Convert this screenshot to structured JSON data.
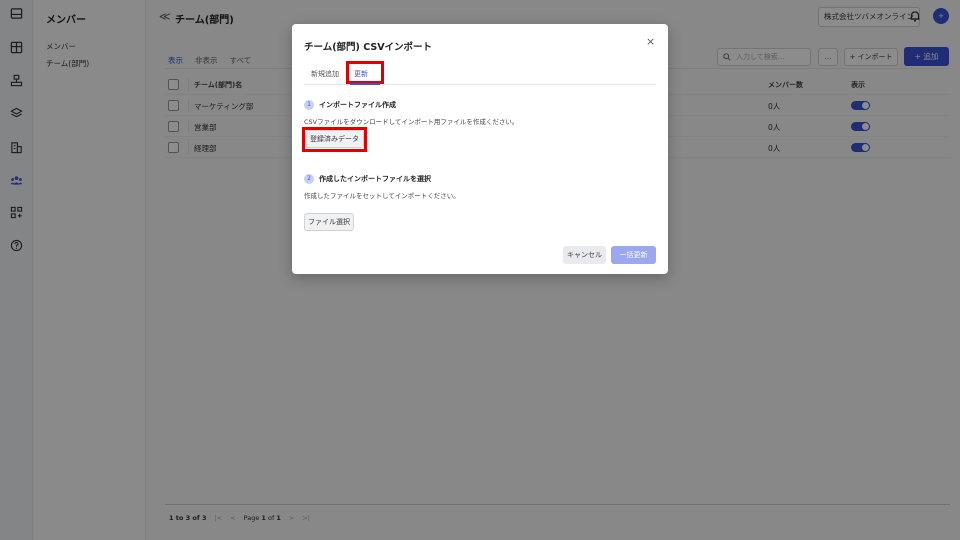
{
  "rail": {
    "icons": [
      "inbox-icon",
      "columns-icon",
      "org-chart-icon",
      "layers-icon",
      "building-icon",
      "team-icon",
      "apps-icon",
      "help-icon"
    ]
  },
  "sidebar": {
    "title": "メンバー",
    "items": [
      {
        "label": "メンバー"
      },
      {
        "label": "チーム(部門)"
      }
    ]
  },
  "header": {
    "back": "≪",
    "title": "チーム(部門)",
    "company": "株式会社ツバメオンライン",
    "avatar_text": "+"
  },
  "filters": {
    "tabs": [
      "表示",
      "非表示",
      "すべて"
    ]
  },
  "toolbar": {
    "search_placeholder": "入力して検索...",
    "more_label": "...",
    "import_label": "+ インポート",
    "add_label": "+ 追加"
  },
  "table": {
    "headers": {
      "name": "チーム(部門)名",
      "count": "メンバー数",
      "display": "表示"
    },
    "rows": [
      {
        "name": "マーケティング部",
        "count": "0人",
        "visible": true
      },
      {
        "name": "営業部",
        "count": "0人",
        "visible": true
      },
      {
        "name": "経理部",
        "count": "0人",
        "visible": true
      }
    ]
  },
  "pagination": {
    "range": "1 to 3 of 3",
    "first": "|<",
    "prev": "<",
    "page_prefix": "Page",
    "page": "1",
    "of": "of",
    "total": "1",
    "next": ">",
    "last": ">|"
  },
  "modal": {
    "title": "チーム(部門) CSVインポート",
    "close": "×",
    "tabs": [
      {
        "label": "新規追加",
        "active": false
      },
      {
        "label": "更新",
        "active": true
      }
    ],
    "step1": {
      "num": "1",
      "title": "インポートファイル作成",
      "desc": "CSVファイルをダウンロードしてインポート用ファイルを作成ください。",
      "button": "登録済みデータ"
    },
    "step2": {
      "num": "2",
      "title": "作成したインポートファイルを選択",
      "desc": "作成したファイルをセットしてインポートください。",
      "button": "ファイル選択"
    },
    "cancel": "キャンセル",
    "submit": "一括更新"
  },
  "colors": {
    "accent": "#3b52d4",
    "highlight": "#e00000"
  }
}
